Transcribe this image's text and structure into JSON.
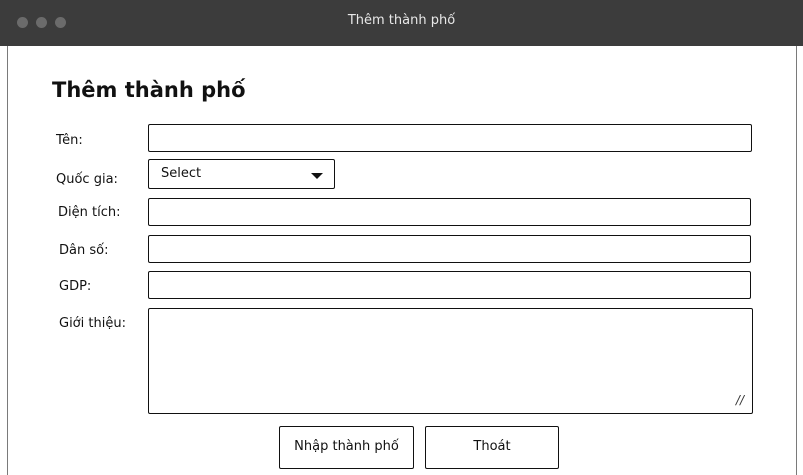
{
  "window": {
    "title": "Thêm thành phố"
  },
  "form": {
    "heading": "Thêm thành phố",
    "fields": {
      "name": {
        "label": "Tên:",
        "value": ""
      },
      "country": {
        "label": "Quốc gia:",
        "selected": "Select"
      },
      "area": {
        "label": "Diện tích:",
        "value": ""
      },
      "population": {
        "label": "Dân số:",
        "value": ""
      },
      "gdp": {
        "label": "GDP:",
        "value": ""
      },
      "intro": {
        "label": "Giới thiệu:",
        "value": ""
      }
    },
    "buttons": {
      "submit": "Nhập thành phố",
      "exit": "Thoát"
    }
  },
  "icons": {
    "window_controls": [
      "close-dot",
      "minimize-dot",
      "maximize-dot"
    ],
    "dropdown": "chevron-down-icon",
    "resize": "resize-handle-icon"
  },
  "colors": {
    "titlebar": "#3c3c3c",
    "title_text": "#e8e8e8",
    "border": "#111111"
  }
}
